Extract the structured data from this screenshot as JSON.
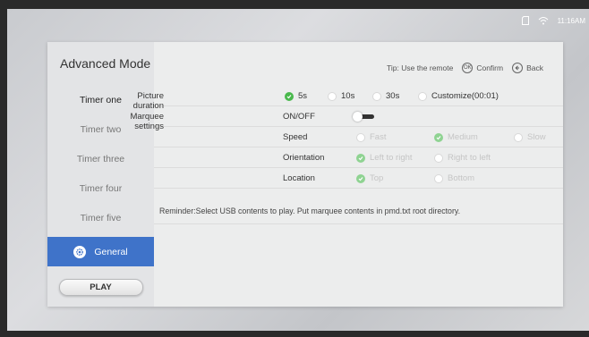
{
  "status": {
    "time": "11:16AM",
    "icons": [
      "sd-card-icon",
      "wifi-icon"
    ]
  },
  "sidebar": {
    "title": "Advanced Mode",
    "items": [
      {
        "label": "Timer one",
        "state": "active"
      },
      {
        "label": "Timer two",
        "state": "normal"
      },
      {
        "label": "Timer three",
        "state": "normal"
      },
      {
        "label": "Timer four",
        "state": "normal"
      },
      {
        "label": "Timer five",
        "state": "normal"
      },
      {
        "label": "General",
        "state": "selected",
        "icon": "gear-icon"
      }
    ],
    "play_label": "PLAY"
  },
  "tip": {
    "text": "Tip: Use the remote",
    "ok_icon_text": "OK",
    "confirm": "Confirm",
    "back": "Back"
  },
  "settings": {
    "picture_duration": {
      "label": "Picture duration",
      "options": [
        "5s",
        "10s",
        "30s",
        "Customize(00:01)"
      ],
      "selected": "5s"
    },
    "marquee": {
      "label": "Marquee settings",
      "value": "ON/OFF",
      "enabled": false
    },
    "speed": {
      "label": "Speed",
      "options": [
        "Fast",
        "Medium",
        "Slow"
      ],
      "selected": "Medium"
    },
    "orientation": {
      "label": "Orientation",
      "options": [
        "Left to right",
        "Right to left"
      ],
      "selected": "Left to right"
    },
    "location": {
      "label": "Location",
      "options": [
        "Top",
        "Bottom"
      ],
      "selected": "Top"
    }
  },
  "reminder": "Reminder:Select USB contents to play. Put marquee contents in pmd.txt root directory.",
  "colors": {
    "accent": "#3f73c9",
    "check": "#49b84c"
  }
}
